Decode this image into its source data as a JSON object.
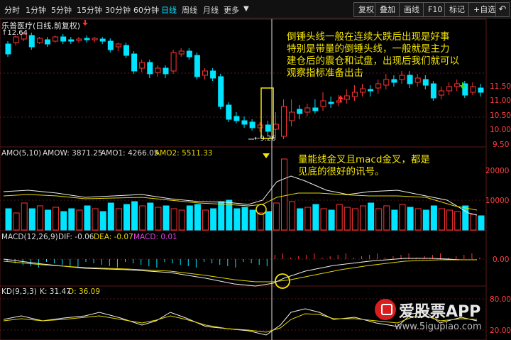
{
  "toolbar": {
    "timeframes": [
      "分时",
      "1分钟",
      "5分钟",
      "15分钟",
      "30分钟",
      "60分钟",
      "日线",
      "周线",
      "月线",
      "更多"
    ],
    "active_timeframe": "日线",
    "buttons": [
      "复权",
      "叠加",
      "画线",
      "F10",
      "标记",
      "+自选"
    ],
    "back_icon": "back-arrow-icon"
  },
  "stock": {
    "title": "乐普医疗(日线,前复权)",
    "high_marker": "12.64",
    "low_marker": "9.26"
  },
  "annotations": {
    "hammer": [
      "倒锤头线一般在连续大跌后出现是好事",
      "特别是带量的倒锤头线，一般就是主力",
      "建仓后的震仓和试盘，出现后我们就可以",
      "观察指标准备出击"
    ],
    "volume": [
      "量能线金叉且macd金叉，都是",
      "见底的很好的讯号。"
    ]
  },
  "amo": {
    "title": "AMO(5,10)",
    "amow": "AMOW: 3871.25",
    "amo1": "AMO1: 4266.05",
    "amo2": "AMO2: 5511.33"
  },
  "macd": {
    "title": "MACD(12,26,9)",
    "dif": "DIF: -0.06",
    "dea": "DEA: -0.07",
    "macd": "MACD: 0.01"
  },
  "kd": {
    "title": "KD(9,3,3)",
    "k": "K: 31.47",
    "d": "D: 36.09"
  },
  "axis": {
    "price_ticks": [
      "11.50",
      "11.00",
      "10.50",
      "10.00",
      "9.50"
    ],
    "amo_ticks": [
      "20000",
      "10000"
    ],
    "macd_ticks": [
      "0.00"
    ],
    "kd_ticks": [
      "80.00",
      "20.00"
    ]
  },
  "watermark": {
    "brand": "爱股票APP",
    "url": "www.5igupiao.com"
  },
  "colors": {
    "up": "#ff3333",
    "down": "#00e5ff",
    "annotation": "#f5e600"
  }
}
